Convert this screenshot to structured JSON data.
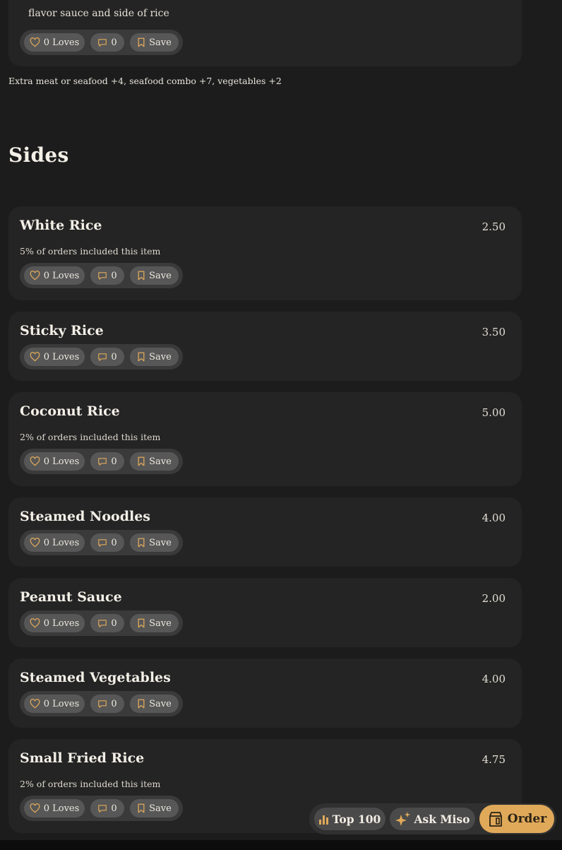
{
  "partial_item": {
    "description_cut": "",
    "description": "flavor sauce and side of rice",
    "loves": "0 Loves",
    "comments": "0",
    "save": "Save"
  },
  "modifiers_note": "Extra meat or seafood +4, seafood combo +7, vegetables +2",
  "section": {
    "title": "Sides"
  },
  "items": [
    {
      "name": "White Rice",
      "price": "2.50",
      "stat": "5% of orders included this item",
      "loves": "0 Loves",
      "comments": "0",
      "save": "Save"
    },
    {
      "name": "Sticky Rice",
      "price": "3.50",
      "stat": "",
      "loves": "0 Loves",
      "comments": "0",
      "save": "Save"
    },
    {
      "name": "Coconut Rice",
      "price": "5.00",
      "stat": "2% of orders included this item",
      "loves": "0 Loves",
      "comments": "0",
      "save": "Save"
    },
    {
      "name": "Steamed Noodles",
      "price": "4.00",
      "stat": "",
      "loves": "0 Loves",
      "comments": "0",
      "save": "Save"
    },
    {
      "name": "Peanut Sauce",
      "price": "2.00",
      "stat": "",
      "loves": "0 Loves",
      "comments": "0",
      "save": "Save"
    },
    {
      "name": "Steamed Vegetables",
      "price": "4.00",
      "stat": "",
      "loves": "0 Loves",
      "comments": "0",
      "save": "Save"
    },
    {
      "name": "Small Fried Rice",
      "price": "4.75",
      "stat": "2% of orders included this item",
      "loves": "0 Loves",
      "comments": "0",
      "save": "Save"
    }
  ],
  "floatbar": {
    "top100": "Top 100",
    "ask_miso": "Ask Miso",
    "order": "Order"
  },
  "colors": {
    "background": "#1c1c1c",
    "card": "#242424",
    "pill": "#575757",
    "accent": "#e0a95a"
  },
  "icons": [
    "heart-icon",
    "comment-icon",
    "bookmark-icon",
    "bar-chart-icon",
    "sparkle-icon",
    "order-bag-icon"
  ]
}
